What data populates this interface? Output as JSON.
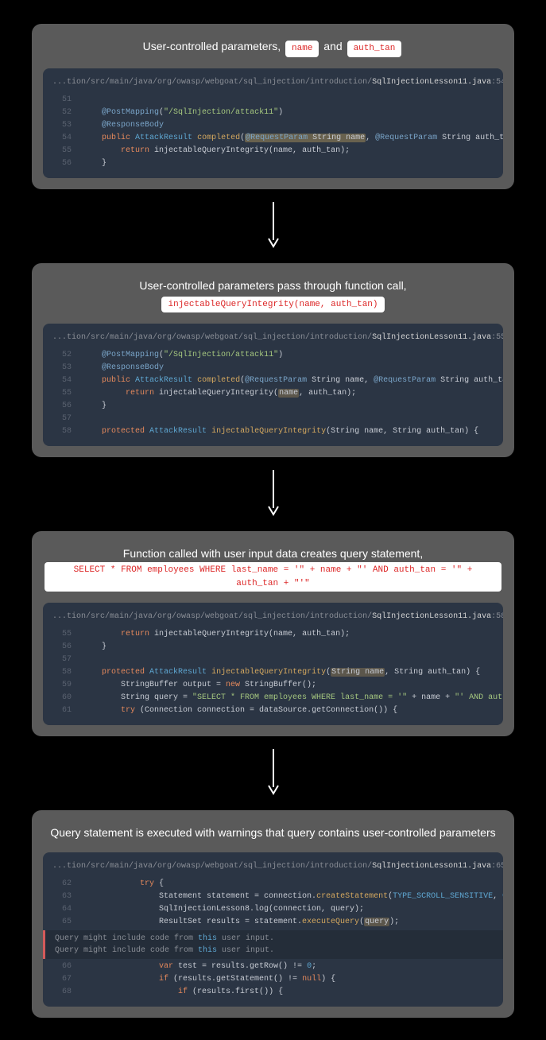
{
  "filePath": "...tion/src/main/java/org/owasp/webgoat/sql_injection/introduction/",
  "fileName": "SqlInjectionLesson11.java",
  "steps": [
    {
      "title_pre": "User-controlled parameters, ",
      "pills": [
        "name",
        "auth_tan"
      ],
      "title_join": " and ",
      "lineno": "54",
      "lines": [
        {
          "n": "51",
          "html": ""
        },
        {
          "n": "52",
          "html": "    <span class='annot'>@PostMapping</span>(<span class='str'>\"/SqlInjection/attack11\"</span>)"
        },
        {
          "n": "53",
          "html": "    <span class='annot'>@ResponseBody</span>"
        },
        {
          "n": "54",
          "html": "    <span class='kw-orange'>public</span> <span class='type'>AttackResult</span> <span class='fn-call'>completed</span>(<span class='hl'><span class='annot'>@RequestParam</span> String name</span>, <span class='annot'>@RequestParam</span> String auth_tan) {"
        },
        {
          "n": "55",
          "html": "        <span class='kw-orange'>return</span> injectableQueryIntegrity(name, auth_tan);"
        },
        {
          "n": "56",
          "html": "    }"
        }
      ]
    },
    {
      "title_pre": "User-controlled parameters pass through function call,",
      "pills": [
        "injectableQueryIntegrity(name, auth_tan)"
      ],
      "title_join": "",
      "break_before_pill": true,
      "lineno": "55",
      "lines": [
        {
          "n": "52",
          "html": "    <span class='annot'>@PostMapping</span>(<span class='str'>\"/SqlInjection/attack11\"</span>)"
        },
        {
          "n": "53",
          "html": "    <span class='annot'>@ResponseBody</span>"
        },
        {
          "n": "54",
          "html": "    <span class='kw-orange'>public</span> <span class='type'>AttackResult</span> <span class='fn-call'>completed</span>(<span class='annot'>@RequestParam</span> String name, <span class='annot'>@RequestParam</span> String auth_tan) {"
        },
        {
          "n": "55",
          "html": "         <span class='kw-orange'>return</span> injectableQueryIntegrity(<span class='hl2'>name</span>, auth_tan);"
        },
        {
          "n": "56",
          "html": "    }"
        },
        {
          "n": "57",
          "html": ""
        },
        {
          "n": "58",
          "html": "    <span class='kw-orange'>protected</span> <span class='type'>AttackResult</span> <span class='fn-call'>injectableQueryIntegrity</span>(String name, String auth_tan) {"
        }
      ]
    },
    {
      "title_pre": "Function called with user input data creates query statement,",
      "pills": [
        "SELECT * FROM employees WHERE last_name = '\" + name + \"' AND auth_tan = '\" + auth_tan + \"'\""
      ],
      "title_join": "",
      "break_before_pill": true,
      "lineno": "58",
      "lines": [
        {
          "n": "55",
          "html": "        <span class='kw-orange'>return</span> injectableQueryIntegrity(name, auth_tan);"
        },
        {
          "n": "56",
          "html": "    }"
        },
        {
          "n": "57",
          "html": ""
        },
        {
          "n": "58",
          "html": "    <span class='kw-orange'>protected</span> <span class='type'>AttackResult</span> <span class='fn-call'>injectableQueryIntegrity</span>(<span class='hl2'>String name</span>, String auth_tan) {"
        },
        {
          "n": "59",
          "html": "        StringBuffer output = <span class='kw-orange'>new</span> StringBuffer();"
        },
        {
          "n": "60",
          "html": "        String query = <span class='str'>\"SELECT * FROM employees WHERE last_name = '\"</span> + name + <span class='str'>\"' AND auth_tan = '\"</span> + auth_tan + <span class='str'>\"'\"</span>;"
        },
        {
          "n": "61",
          "html": "        <span class='kw-orange'>try</span> (Connection connection = dataSource.getConnection()) {"
        }
      ]
    },
    {
      "title_pre": "Query statement is executed with warnings that query contains user-controlled parameters",
      "pills": [],
      "title_join": "",
      "lineno": "65",
      "lines": [
        {
          "n": "62",
          "html": "            <span class='kw-orange'>try</span> {"
        },
        {
          "n": "63",
          "html": "                Statement statement = connection.<span class='fn-call'>createStatement</span>(<span class='type'>TYPE_SCROLL_SENSITIVE</span>, <span class='type'>CONCUR_UPDATABLE</span>);"
        },
        {
          "n": "64",
          "html": "                SqlInjectionLesson8.log(connection, query);"
        },
        {
          "n": "65",
          "html": "                ResultSet results = statement.<span class='fn-call'>executeQuery</span>(<span class='hl2'>query</span>);"
        }
      ],
      "warnings": [
        "Query might include code from <span class='kw'>this</span> user input.",
        "Query might include code from <span class='kw'>this</span> user input."
      ],
      "lines_after": [
        {
          "n": "66",
          "html": "                <span class='kw-orange'>var</span> test = results.getRow() != <span class='type'>0</span>;"
        },
        {
          "n": "67",
          "html": "                <span class='kw-orange'>if</span> (results.getStatement() != <span class='kw-orange'>null</span>) {"
        },
        {
          "n": "68",
          "html": "                    <span class='kw-orange'>if</span> (results.first()) {"
        }
      ]
    }
  ]
}
